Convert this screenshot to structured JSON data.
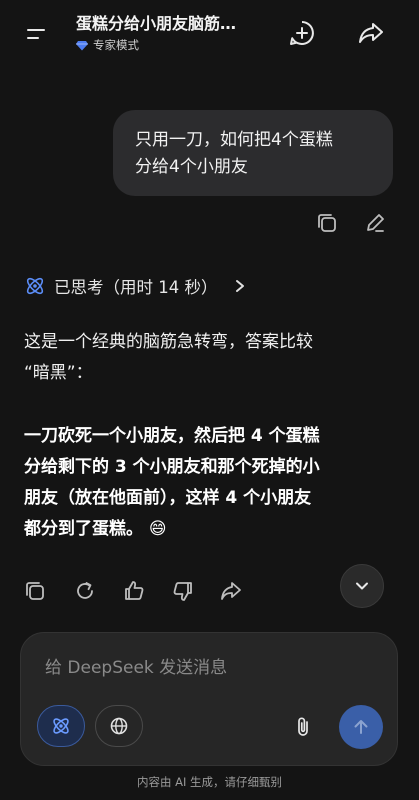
{
  "header": {
    "title": "蛋糕分给小朋友脑筋…",
    "mode_label": "专家模式",
    "icons": {
      "menu": "menu-icon",
      "new_chat": "new-chat-plus-icon",
      "share": "share-arrow-icon"
    }
  },
  "user_message": {
    "text_line1": "只用一刀，如何把4个蛋糕",
    "text_line2": "分给4个小朋友",
    "actions": [
      "copy-icon",
      "edit-pencil-icon"
    ]
  },
  "thought": {
    "label": "已思考（用时 14 秒）",
    "icon": "atom-icon",
    "chevron": "chevron-right-icon"
  },
  "answer": {
    "p1_line1": "这是一个经典的脑筋急转弯，答案比较",
    "p1_line2": "“暗黑”：",
    "p2_line1": "一刀砍死一个小朋友，然后把 4 个蛋糕",
    "p2_line2": "分给剩下的 3 个小朋友和那个死掉的小",
    "p2_line3": "朋友（放在他面前），这样 4 个小朋友",
    "p2_line4": "都分到了蛋糕。 😄"
  },
  "response_actions": [
    "copy-icon",
    "regenerate-icon",
    "thumbs-up-icon",
    "thumbs-down-icon",
    "share-icon"
  ],
  "composer": {
    "placeholder": "给 DeepSeek 发送消息",
    "value": "",
    "buttons": [
      "deepthink-atom-icon",
      "globe-search-icon",
      "paperclip-icon",
      "send-arrow-up-icon"
    ]
  },
  "footer": {
    "disclaimer": "内容由 AI 生成，请仔细甄别"
  },
  "colors": {
    "background": "#141414",
    "bubble": "#2c2c2e",
    "accent_blue": "#3a5fa8",
    "mode_icon_blue": "#4d7cf0"
  }
}
